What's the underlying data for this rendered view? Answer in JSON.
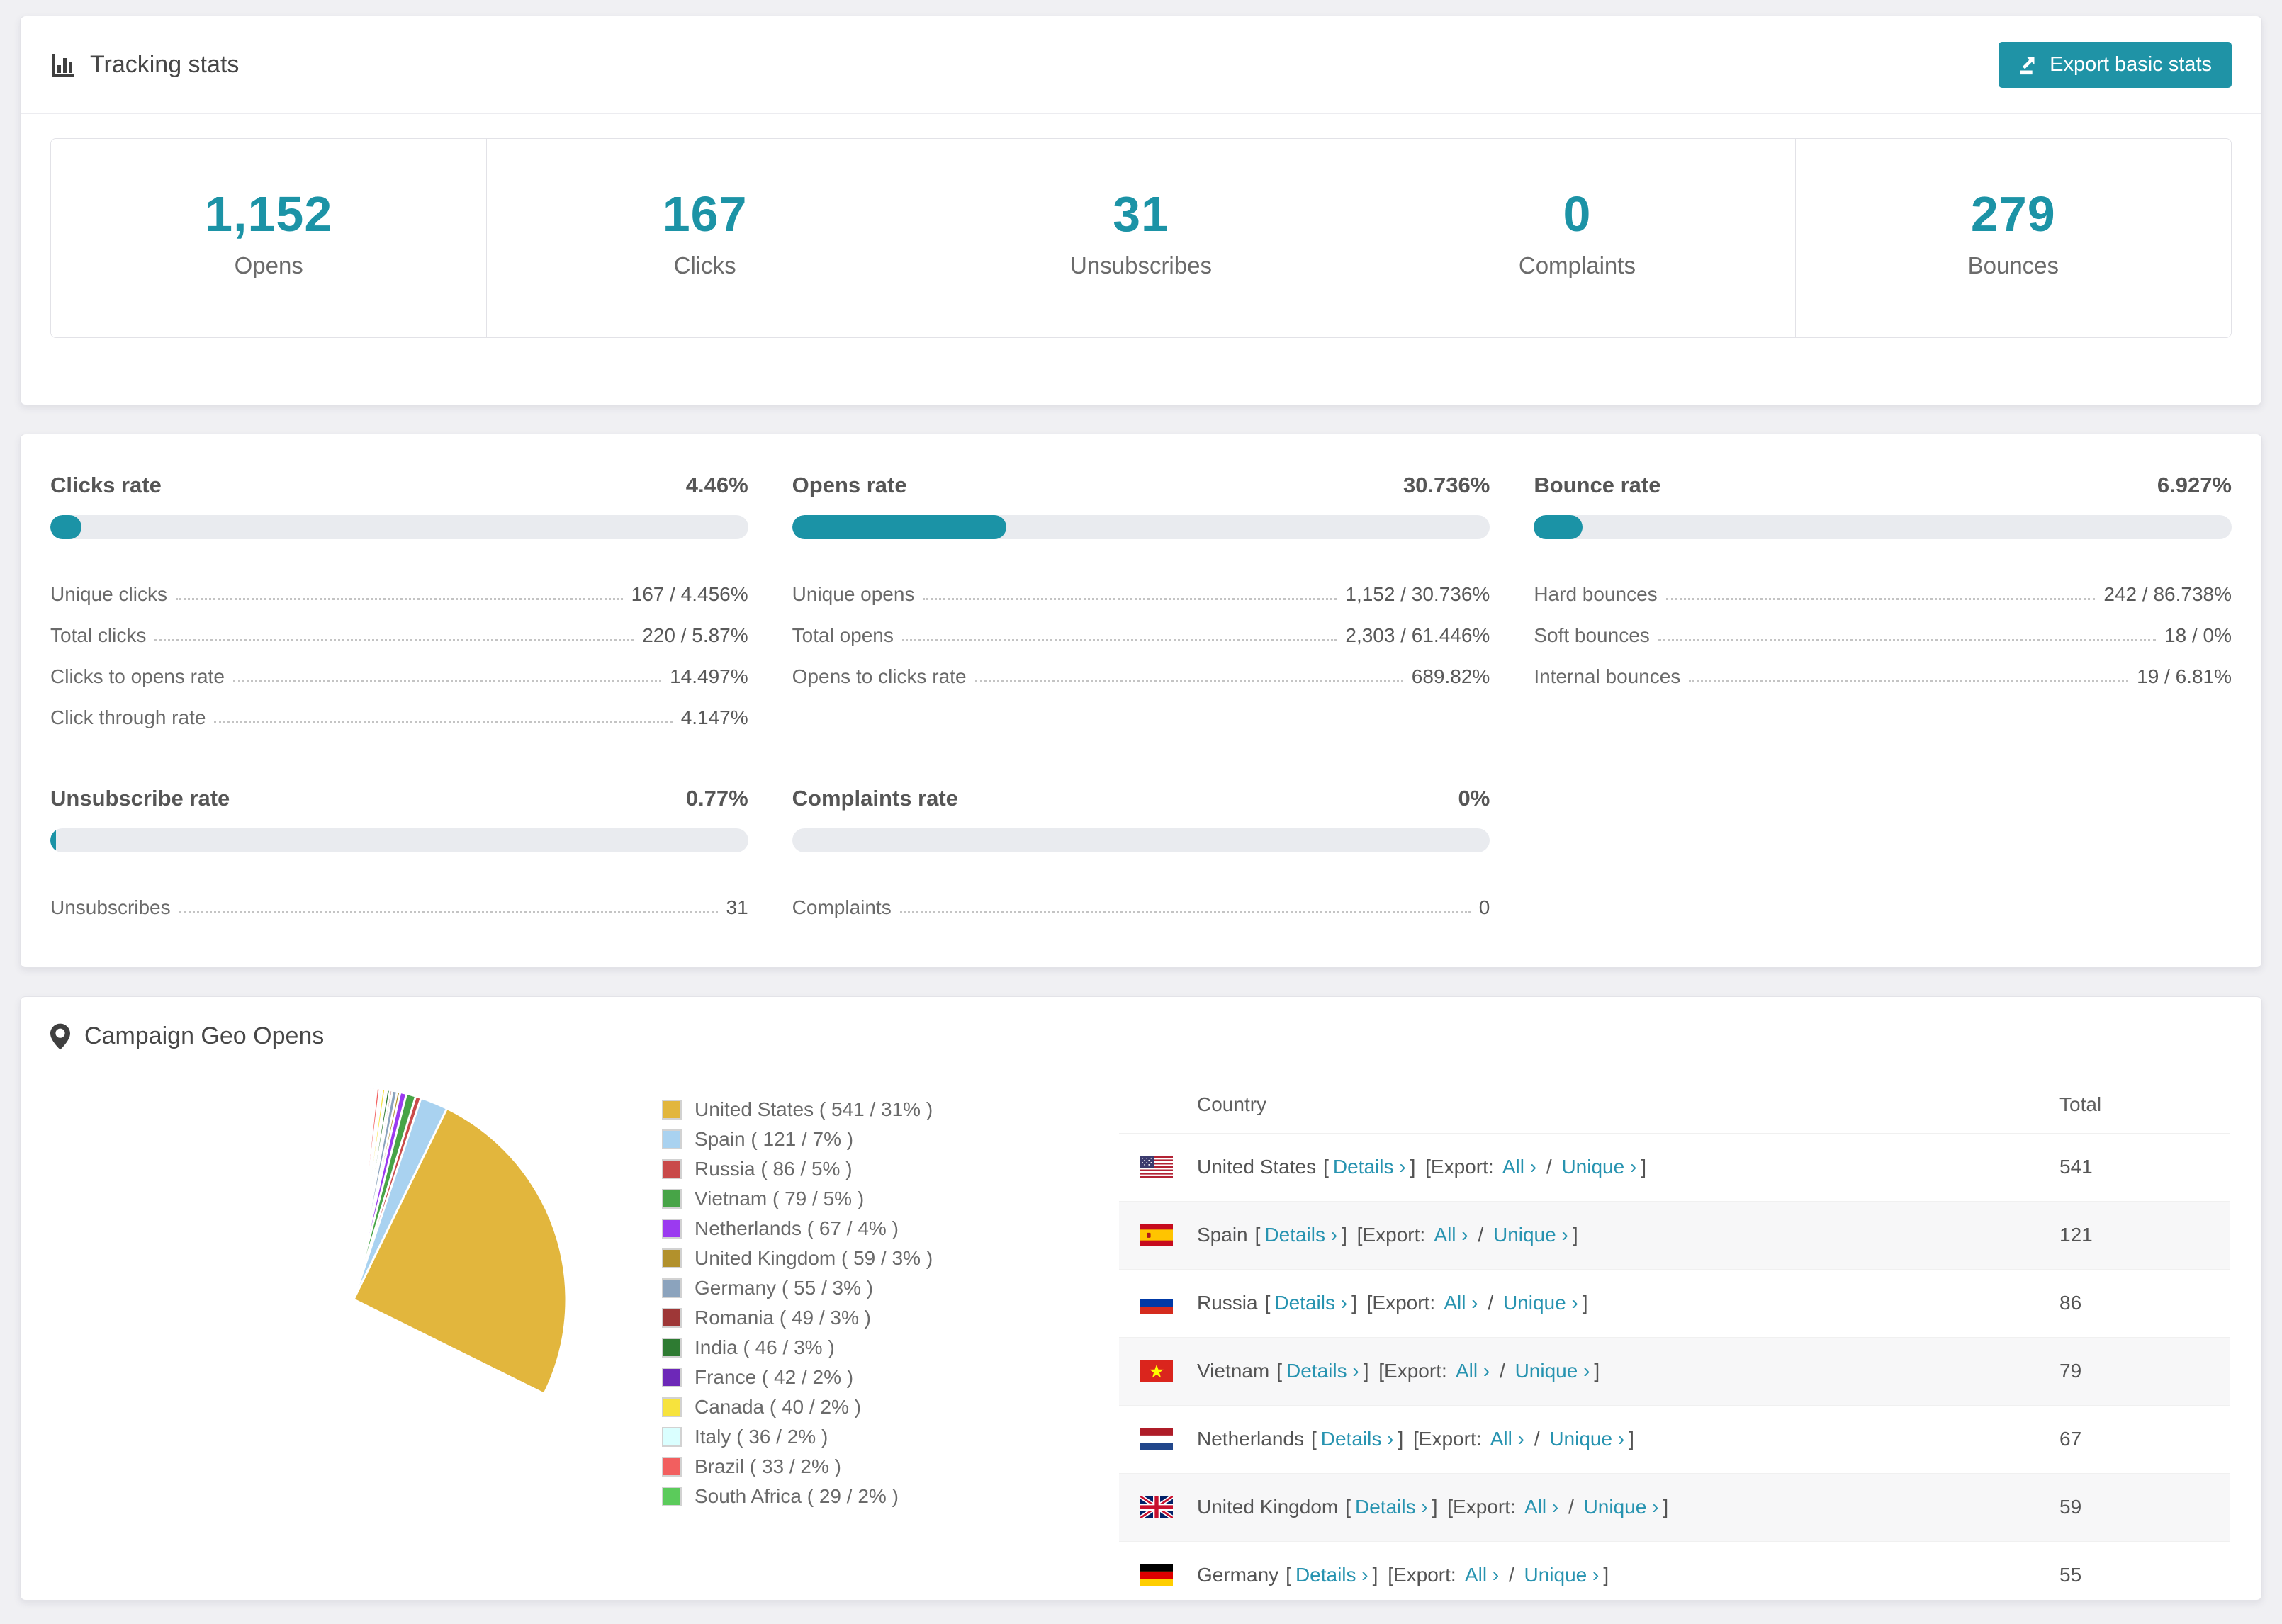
{
  "page": {
    "background": "#f0f0f3",
    "accent_teal": "#1c93a6",
    "link_color": "#2793b0"
  },
  "tracking": {
    "title": "Tracking stats",
    "export_button_label": "Export basic stats",
    "stats": [
      {
        "value": "1,152",
        "label": "Opens"
      },
      {
        "value": "167",
        "label": "Clicks"
      },
      {
        "value": "31",
        "label": "Unsubscribes"
      },
      {
        "value": "0",
        "label": "Complaints"
      },
      {
        "value": "279",
        "label": "Bounces"
      }
    ]
  },
  "rates": {
    "panels": [
      {
        "title": "Clicks rate",
        "value": "4.46%",
        "percent": 4.46,
        "rows": [
          {
            "label": "Unique clicks",
            "value": "167 / 4.456%"
          },
          {
            "label": "Total clicks",
            "value": "220 / 5.87%"
          },
          {
            "label": "Clicks to opens rate",
            "value": "14.497%"
          },
          {
            "label": "Click through rate",
            "value": "4.147%"
          }
        ]
      },
      {
        "title": "Opens rate",
        "value": "30.736%",
        "percent": 30.736,
        "rows": [
          {
            "label": "Unique opens",
            "value": "1,152 / 30.736%"
          },
          {
            "label": "Total opens",
            "value": "2,303 / 61.446%"
          },
          {
            "label": "Opens to clicks rate",
            "value": "689.82%"
          }
        ]
      },
      {
        "title": "Bounce rate",
        "value": "6.927%",
        "percent": 6.927,
        "rows": [
          {
            "label": "Hard bounces",
            "value": "242 / 86.738%"
          },
          {
            "label": "Soft bounces",
            "value": "18 / 0%"
          },
          {
            "label": "Internal bounces",
            "value": "19 / 6.81%"
          }
        ]
      },
      {
        "title": "Unsubscribe rate",
        "value": "0.77%",
        "percent": 0.77,
        "rows": [
          {
            "label": "Unsubscribes",
            "value": "31"
          }
        ]
      },
      {
        "title": "Complaints rate",
        "value": "0%",
        "percent": 0,
        "rows": [
          {
            "label": "Complaints",
            "value": "0"
          }
        ]
      }
    ]
  },
  "chart_data": {
    "type": "pie",
    "title": "Campaign Geo Opens",
    "legend_position": "right",
    "series": [
      {
        "name": "United States",
        "value": 541,
        "pct": 31,
        "color": "#e2b63d",
        "legend_label": "United States ( 541 / 31% )"
      },
      {
        "name": "Spain",
        "value": 121,
        "pct": 7,
        "color": "#a9d2f0",
        "legend_label": "Spain ( 121 / 7% )"
      },
      {
        "name": "Russia",
        "value": 86,
        "pct": 5,
        "color": "#c94a4a",
        "legend_label": "Russia ( 86 / 5% )"
      },
      {
        "name": "Vietnam",
        "value": 79,
        "pct": 5,
        "color": "#47a447",
        "legend_label": "Vietnam ( 79 / 5% )"
      },
      {
        "name": "Netherlands",
        "value": 67,
        "pct": 4,
        "color": "#9b3af0",
        "legend_label": "Netherlands ( 67 / 4% )"
      },
      {
        "name": "United Kingdom",
        "value": 59,
        "pct": 3,
        "color": "#b2912c",
        "legend_label": "United Kingdom ( 59 / 3% )"
      },
      {
        "name": "Germany",
        "value": 55,
        "pct": 3,
        "color": "#8ba3bd",
        "legend_label": "Germany ( 55 / 3% )"
      },
      {
        "name": "Romania",
        "value": 49,
        "pct": 3,
        "color": "#9e3737",
        "legend_label": "Romania ( 49 / 3% )"
      },
      {
        "name": "India",
        "value": 46,
        "pct": 3,
        "color": "#2e7b32",
        "legend_label": "India ( 46 / 3% )"
      },
      {
        "name": "France",
        "value": 42,
        "pct": 2,
        "color": "#6d28b8",
        "legend_label": "France ( 42 / 2% )"
      },
      {
        "name": "Canada",
        "value": 40,
        "pct": 2,
        "color": "#f7e33d",
        "legend_label": "Canada ( 40 / 2% )"
      },
      {
        "name": "Italy",
        "value": 36,
        "pct": 2,
        "color": "#daffff",
        "legend_label": "Italy ( 36 / 2% )"
      },
      {
        "name": "Brazil",
        "value": 33,
        "pct": 2,
        "color": "#f25f5f",
        "legend_label": "Brazil ( 33 / 2% )"
      },
      {
        "name": "South Africa",
        "value": 29,
        "pct": 2,
        "color": "#5bcb5b",
        "legend_label": "South Africa ( 29 / 2% )"
      }
    ],
    "others_unlabeled": [
      27,
      26,
      24,
      23,
      22,
      20,
      19,
      18,
      17,
      16,
      15,
      14,
      13,
      12,
      11,
      10,
      9,
      9,
      8,
      8,
      7,
      7,
      6,
      6,
      5,
      5,
      4,
      4,
      3,
      3,
      3,
      2,
      2,
      2,
      2,
      1,
      1,
      1,
      1,
      1,
      1,
      1,
      1,
      1
    ]
  },
  "geo": {
    "title": "Campaign Geo Opens",
    "table": {
      "columns": {
        "country": "Country",
        "total": "Total"
      },
      "labels": {
        "open": "[",
        "close": "]",
        "export": "[Export:",
        "details": "Details ›",
        "all": "All ›",
        "unique": "Unique ›",
        "slash": "/"
      },
      "rows": [
        {
          "flag": "us",
          "country": "United States",
          "total": "541"
        },
        {
          "flag": "es",
          "country": "Spain",
          "total": "121"
        },
        {
          "flag": "ru",
          "country": "Russia",
          "total": "86"
        },
        {
          "flag": "vn",
          "country": "Vietnam",
          "total": "79"
        },
        {
          "flag": "nl",
          "country": "Netherlands",
          "total": "67"
        },
        {
          "flag": "gb",
          "country": "United Kingdom",
          "total": "59"
        },
        {
          "flag": "de",
          "country": "Germany",
          "total": "55"
        }
      ]
    }
  }
}
